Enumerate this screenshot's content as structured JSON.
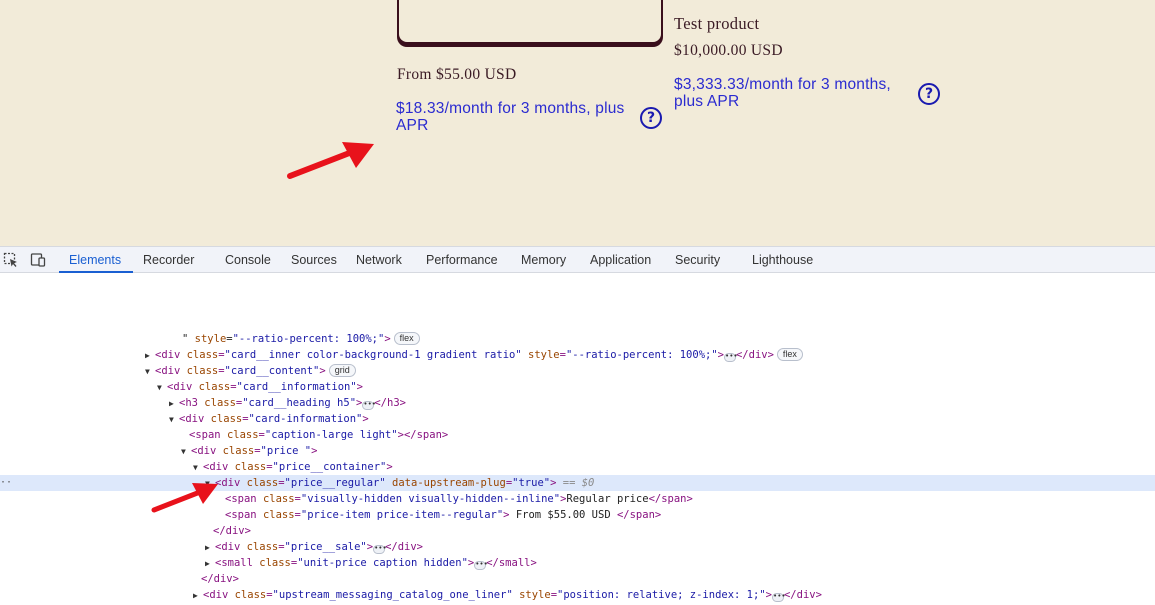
{
  "store": {
    "card1": {
      "price_from": "From $55.00 USD",
      "monthly": "$18.33/month for 3 months, plus APR",
      "help_glyph": "?"
    },
    "card2": {
      "heading": "Test product",
      "price": "$10,000.00 USD",
      "monthly": "$3,333.33/month for 3 months, plus APR",
      "help_glyph": "?"
    },
    "arrow_color": "#e8121b"
  },
  "devtools": {
    "tabs": [
      "Elements",
      "Recorder",
      "Console",
      "Sources",
      "Network",
      "Performance",
      "Memory",
      "Application",
      "Security",
      "Lighthouse"
    ],
    "active_tab": "Elements",
    "tree": [
      {
        "pre": "\" ",
        "attr1": "style",
        "val1": "\"--ratio-percent: 100%;\"",
        "post": ">",
        "badge": "flex"
      },
      {
        "tag_open": "<div ",
        "attr1": "class",
        "val1": "\"card__inner color-background-1 gradient ratio\"",
        "attr2": "style",
        "val2": "\"--ratio-percent: 100%;\"",
        "close": "</div>",
        "badge": "flex"
      },
      {
        "tag_open": "<div ",
        "attr1": "class",
        "val1": "\"card__content\"",
        "badge": "grid"
      },
      {
        "tag_open": "<div ",
        "attr1": "class",
        "val1": "\"card__information\""
      },
      {
        "tag_open": "<h3 ",
        "attr1": "class",
        "val1": "\"card__heading h5\"",
        "close": "</h3>"
      },
      {
        "tag_open": "<div ",
        "attr1": "class",
        "val1": "\"card-information\""
      },
      {
        "tag_open": "<span ",
        "attr1": "class",
        "val1": "\"caption-large light\"",
        "close": "</span>"
      },
      {
        "tag_open": "<div ",
        "attr1": "class",
        "val1": "\"price \""
      },
      {
        "tag_open": "<div ",
        "attr1": "class",
        "val1": "\"price__container\""
      },
      {
        "tag_open": "<div ",
        "attr1": "class",
        "val1": "\"price__regular\"",
        "attr2": "data-upstream-plug",
        "val2": "\"true\"",
        "suffix": "== $0"
      },
      {
        "tag_open": "<span ",
        "attr1": "class",
        "val1": "\"visually-hidden visually-hidden--inline\"",
        "text": "Regular price",
        "close": "</span>"
      },
      {
        "tag_open": "<span ",
        "attr1": "class",
        "val1": "\"price-item price-item--regular\"",
        "text": " From $55.00 USD ",
        "close": "</span>"
      },
      {
        "close_only": "</div>"
      },
      {
        "tag_open": "<div ",
        "attr1": "class",
        "val1": "\"price__sale\"",
        "close": "</div>"
      },
      {
        "tag_open": "<small ",
        "attr1": "class",
        "val1": "\"unit-price caption hidden\"",
        "close": "</small>"
      },
      {
        "close_only": "</div>"
      },
      {
        "tag_open": "<div ",
        "attr1": "class",
        "val1": "\"upstream_messaging_catalog_one_liner\"",
        "attr2": "style",
        "val2": "\"position: relative; z-index: 1;\"",
        "close": "</div>"
      }
    ],
    "gutter_dots": "··"
  }
}
